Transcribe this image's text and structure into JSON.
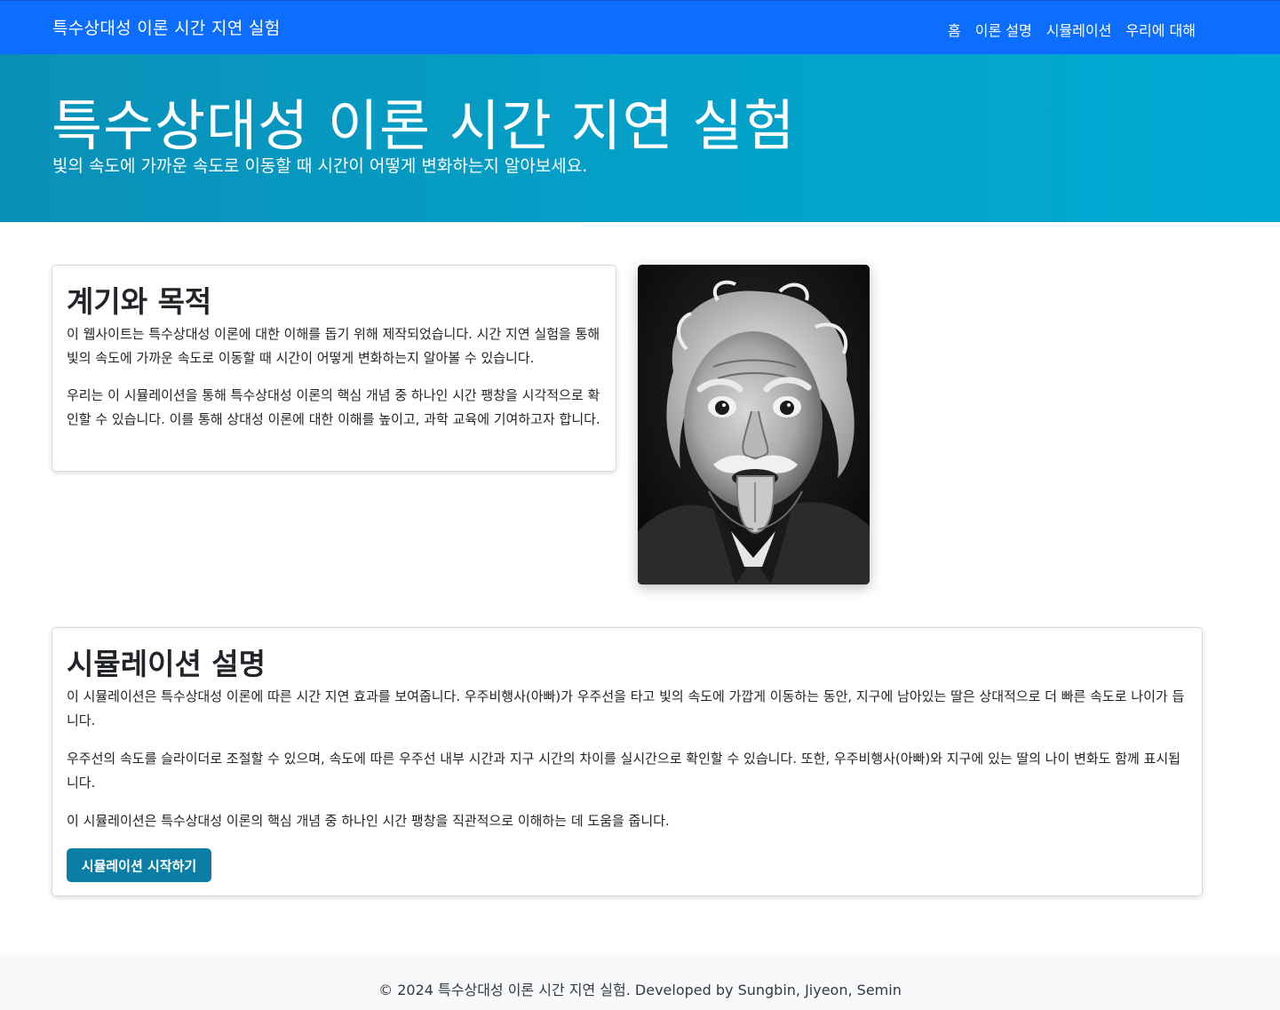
{
  "navbar": {
    "brand": "특수상대성 이론 시간 지연 실험",
    "links": [
      "홈",
      "이론 설명",
      "시뮬레이션",
      "우리에 대해"
    ]
  },
  "hero": {
    "title": "특수상대성 이론 시간 지연 실험",
    "subtitle": "빛의 속도에 가까운 속도로 이동할 때 시간이 어떻게 변화하는지 알아보세요."
  },
  "motivation": {
    "title": "계기와 목적",
    "paragraphs": [
      "이 웹사이트는 특수상대성 이론에 대한 이해를 돕기 위해 제작되었습니다. 시간 지연 실험을 통해 빛의 속도에 가까운 속도로 이동할 때 시간이 어떻게 변화하는지 알아볼 수 있습니다.",
      "우리는 이 시뮬레이션을 통해 특수상대성 이론의 핵심 개념 중 하나인 시간 팽창을 시각적으로 확인할 수 있습니다. 이를 통해 상대성 이론에 대한 이해를 높이고, 과학 교육에 기여하고자 합니다."
    ]
  },
  "simulation": {
    "title": "시뮬레이션 설명",
    "paragraphs": [
      "이 시뮬레이션은 특수상대성 이론에 따른 시간 지연 효과를 보여줍니다. 우주비행사(아빠)가 우주선을 타고 빛의 속도에 가깝게 이동하는 동안, 지구에 남아있는 딸은 상대적으로 더 빠른 속도로 나이가 듭니다.",
      "우주선의 속도를 슬라이더로 조절할 수 있으며, 속도에 따른 우주선 내부 시간과 지구 시간의 차이를 실시간으로 확인할 수 있습니다. 또한, 우주비행사(아빠)와 지구에 있는 딸의 나이 변화도 함께 표시됩니다.",
      "이 시뮬레이션은 특수상대성 이론의 핵심 개념 중 하나인 시간 팽창을 직관적으로 이해하는 데 도움을 줍니다."
    ],
    "start_button": "시뮬레이션 시작하기"
  },
  "footer": {
    "text": "© 2024 특수상대성 이론 시간 지연 실험. Developed by Sungbin, Jiyeon, Semin"
  },
  "colors": {
    "navbar": "#0d6efd",
    "hero_gradient_start": "#0a90b8",
    "hero_gradient_end": "#00aad3",
    "button": "#0a7ea4",
    "footer": "#f8f9fa"
  }
}
